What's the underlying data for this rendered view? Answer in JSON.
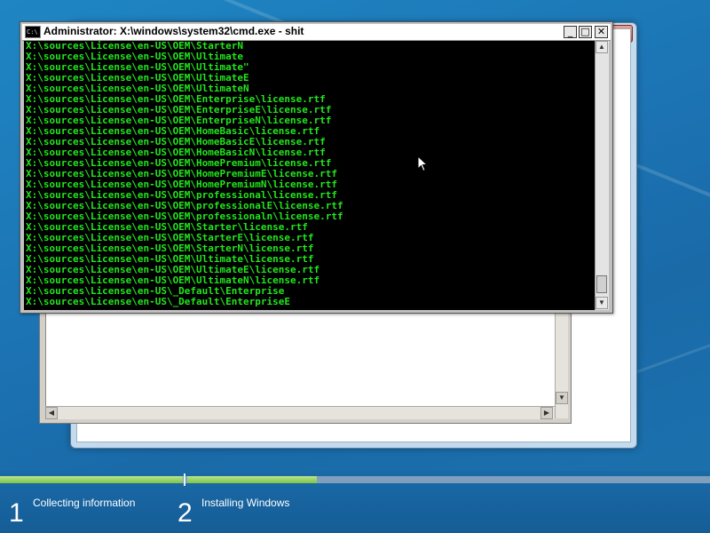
{
  "cmd_window": {
    "title": "Administrator: X:\\windows\\system32\\cmd.exe - shit",
    "icon_text": "C:\\",
    "minimize_glyph": "_",
    "maximize_glyph": "□",
    "close_glyph": "✕",
    "lines": [
      "X:\\sources\\License\\en-US\\OEM\\StarterN",
      "X:\\sources\\License\\en-US\\OEM\\Ultimate",
      "X:\\sources\\License\\en-US\\OEM\\Ultimate\"",
      "X:\\sources\\License\\en-US\\OEM\\UltimateE",
      "X:\\sources\\License\\en-US\\OEM\\UltimateN",
      "X:\\sources\\License\\en-US\\OEM\\Enterprise\\license.rtf",
      "X:\\sources\\License\\en-US\\OEM\\EnterpriseE\\license.rtf",
      "X:\\sources\\License\\en-US\\OEM\\EnterpriseN\\license.rtf",
      "X:\\sources\\License\\en-US\\OEM\\HomeBasic\\license.rtf",
      "X:\\sources\\License\\en-US\\OEM\\HomeBasicE\\license.rtf",
      "X:\\sources\\License\\en-US\\OEM\\HomeBasicN\\license.rtf",
      "X:\\sources\\License\\en-US\\OEM\\HomePremium\\license.rtf",
      "X:\\sources\\License\\en-US\\OEM\\HomePremiumE\\license.rtf",
      "X:\\sources\\License\\en-US\\OEM\\HomePremiumN\\license.rtf",
      "X:\\sources\\License\\en-US\\OEM\\professional\\license.rtf",
      "X:\\sources\\License\\en-US\\OEM\\professionalE\\license.rtf",
      "X:\\sources\\License\\en-US\\OEM\\professionaln\\license.rtf",
      "X:\\sources\\License\\en-US\\OEM\\Starter\\license.rtf",
      "X:\\sources\\License\\en-US\\OEM\\StarterE\\license.rtf",
      "X:\\sources\\License\\en-US\\OEM\\StarterN\\license.rtf",
      "X:\\sources\\License\\en-US\\OEM\\Ultimate\\license.rtf",
      "X:\\sources\\License\\en-US\\OEM\\UltimateE\\license.rtf",
      "X:\\sources\\License\\en-US\\OEM\\UltimateN\\license.rtf",
      "X:\\sources\\License\\en-US\\_Default\\Enterprise",
      "X:\\sources\\License\\en-US\\_Default\\EnterpriseE"
    ]
  },
  "setup_window": {
    "close_glyph": "✕"
  },
  "progress": {
    "steps": [
      {
        "number": "1",
        "label": "Collecting information"
      },
      {
        "number": "2",
        "label": "Installing Windows"
      }
    ],
    "colors": {
      "complete": "#8fd15a",
      "rail": "#7f9fbd"
    }
  },
  "scroll_glyphs": {
    "up": "▲",
    "down": "▼",
    "left": "◀",
    "right": "▶"
  }
}
